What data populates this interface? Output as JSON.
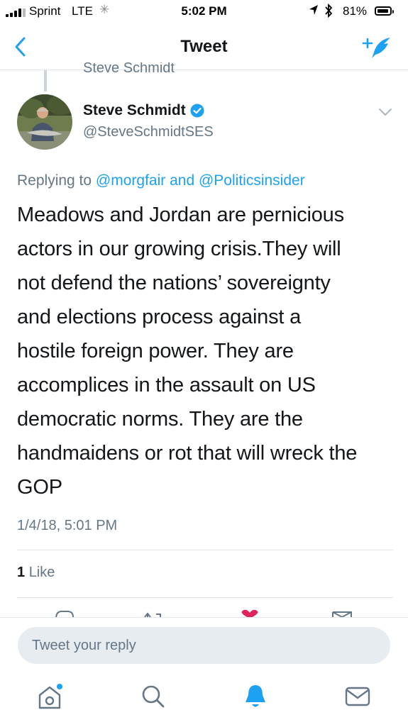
{
  "status_bar": {
    "carrier": "Sprint",
    "network": "LTE",
    "time": "5:02 PM",
    "battery_percent": "81%",
    "battery_level": 0.81
  },
  "nav": {
    "title": "Tweet",
    "back_icon": "chevron-left-icon",
    "compose_icon": "compose-tweet-icon"
  },
  "thread": {
    "previous_author": "Steve Schmidt"
  },
  "tweet": {
    "author_name": "Steve Schmidt",
    "author_handle": "@SteveSchmidtSES",
    "verified": true,
    "replying_prefix": "Replying to",
    "mentions": [
      "@morgfair",
      "@Politicsinsider"
    ],
    "mention_joiner": "and",
    "text_lines": [
      "Meadows and Jordan are pernicious",
      "actors in our growing crisis.They will",
      "not defend the nations’ sovereignty",
      "and elections process against a",
      "hostile foreign power. They are",
      "accomplices in the assault on US",
      "democratic norms. They are the",
      "handmaidens or rot that will wreck the",
      "GOP"
    ],
    "timestamp": "1/4/18, 5:01 PM",
    "like_count": "1",
    "like_label": "Like"
  },
  "composer": {
    "placeholder": "Tweet your reply"
  },
  "tab_bar": {
    "items": [
      "home-icon",
      "search-icon",
      "notifications-icon",
      "messages-icon"
    ]
  },
  "colors": {
    "accent": "#1da1f2",
    "like": "#e0245e",
    "secondary_text": "#657786"
  }
}
